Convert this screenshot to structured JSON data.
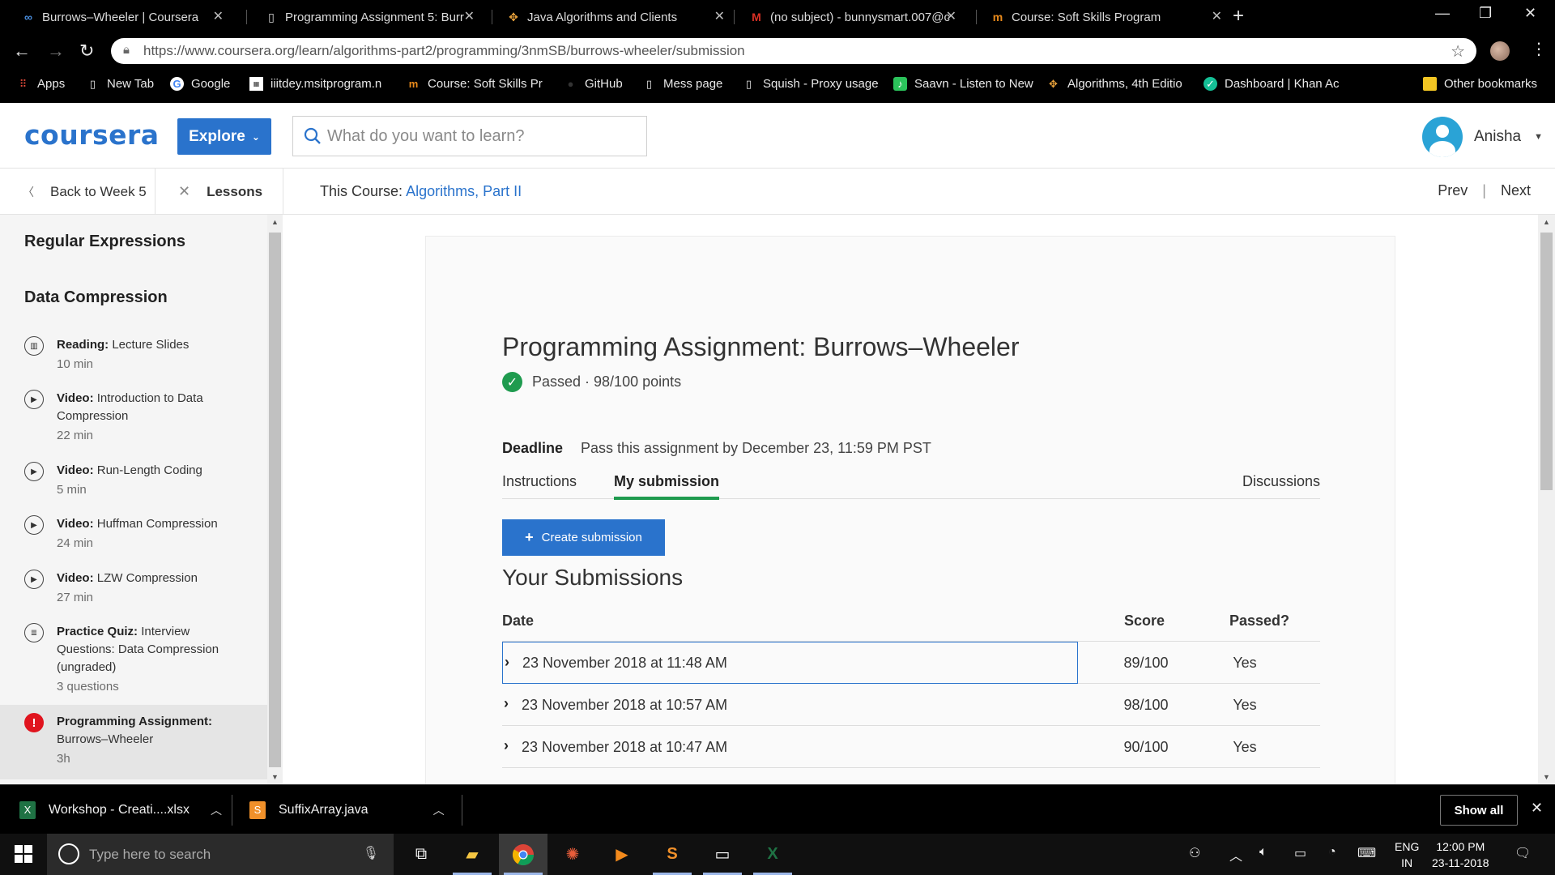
{
  "browser": {
    "tabs": [
      {
        "title": "Burrows–Wheeler | Coursera",
        "icon": "coursera-icon"
      },
      {
        "title": "Programming Assignment 5: Burr",
        "icon": "document-icon"
      },
      {
        "title": "Java Algorithms and Clients",
        "icon": "algorithms-icon"
      },
      {
        "title": "(no subject) - bunnysmart.007@c",
        "icon": "gmail-icon"
      },
      {
        "title": "Course: Soft Skills Program",
        "icon": "msit-icon"
      }
    ],
    "url": "https://www.coursera.org/learn/algorithms-part2/programming/3nmSB/burrows-wheeler/submission",
    "bookmarks": [
      "Apps",
      "New Tab",
      "Google",
      "iiitdey.msitprogram.n",
      "Course: Soft Skills Pr",
      "GitHub",
      "Mess page",
      "Squish - Proxy usage",
      "Saavn - Listen to New",
      "Algorithms, 4th Editio",
      "Dashboard | Khan Ac",
      "Other bookmarks"
    ]
  },
  "header": {
    "logo": "coursera",
    "explore": "Explore",
    "search_placeholder": "What do you want to learn?",
    "user_name": "Anisha"
  },
  "subheader": {
    "back": "Back to Week 5",
    "lessons": "Lessons",
    "course_prefix": "This Course:",
    "course_name": "Algorithms, Part II",
    "prev": "Prev",
    "next": "Next"
  },
  "sidebar": {
    "sections": [
      "Regular Expressions",
      "Data Compression"
    ],
    "items": [
      {
        "type": "Reading:",
        "title": "Lecture Slides",
        "meta": "10 min",
        "icon": "book-icon"
      },
      {
        "type": "Video:",
        "title": "Introduction to Data",
        "title2": "Compression",
        "meta": "22 min",
        "icon": "play-icon"
      },
      {
        "type": "Video:",
        "title": "Run-Length Coding",
        "meta": "5 min",
        "icon": "play-icon"
      },
      {
        "type": "Video:",
        "title": "Huffman Compression",
        "meta": "24 min",
        "icon": "play-icon"
      },
      {
        "type": "Video:",
        "title": "LZW Compression",
        "meta": "27 min",
        "icon": "play-icon"
      },
      {
        "type": "Practice Quiz:",
        "title": "Interview",
        "title2": "Questions: Data Compression",
        "title3": "(ungraded)",
        "meta": "3 questions",
        "icon": "quiz-icon"
      },
      {
        "type": "Programming Assignment:",
        "title": "Burrows–Wheeler",
        "meta": "3h",
        "icon": "alert-icon"
      }
    ]
  },
  "assignment": {
    "title": "Programming Assignment: Burrows–Wheeler",
    "status": "Passed · 98/100 points",
    "deadline_label": "Deadline",
    "deadline_text": "Pass this assignment by December 23, 11:59 PM PST",
    "tabs": [
      "Instructions",
      "My submission",
      "Discussions"
    ],
    "create_button": "Create submission",
    "submissions_title": "Your Submissions",
    "columns": [
      "Date",
      "Score",
      "Passed?"
    ],
    "rows": [
      {
        "date": "23 November 2018 at 11:48 AM",
        "score": "89/100",
        "passed": "Yes"
      },
      {
        "date": "23 November 2018 at 10:57 AM",
        "score": "98/100",
        "passed": "Yes"
      },
      {
        "date": "23 November 2018 at 10:47 AM",
        "score": "90/100",
        "passed": "Yes"
      }
    ]
  },
  "downloads": {
    "items": [
      "Workshop - Creati....xlsx",
      "SuffixArray.java"
    ],
    "show_all": "Show all"
  },
  "taskbar": {
    "search_placeholder": "Type here to search",
    "lang1": "ENG",
    "lang2": "IN",
    "time": "12:00 PM",
    "date": "23-11-2018"
  },
  "colors": {
    "brand_blue": "#2a73cc",
    "passed_green": "#1f9b4f",
    "alert_red": "#e0141e"
  }
}
